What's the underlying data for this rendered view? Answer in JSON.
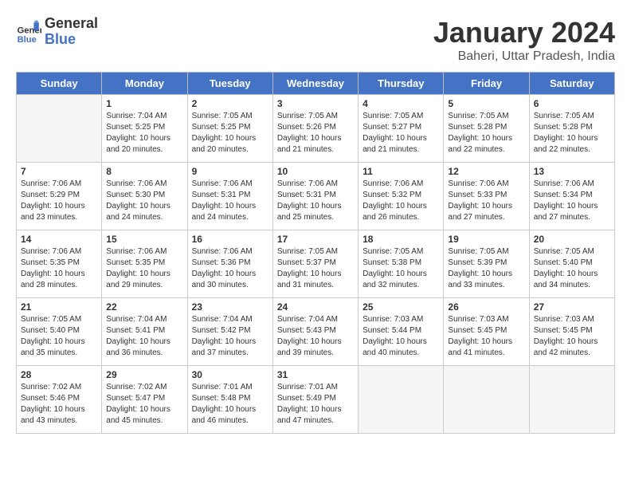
{
  "header": {
    "logo_line1": "General",
    "logo_line2": "Blue",
    "month": "January 2024",
    "location": "Baheri, Uttar Pradesh, India"
  },
  "days_of_week": [
    "Sunday",
    "Monday",
    "Tuesday",
    "Wednesday",
    "Thursday",
    "Friday",
    "Saturday"
  ],
  "weeks": [
    [
      {
        "num": "",
        "info": ""
      },
      {
        "num": "1",
        "info": "Sunrise: 7:04 AM\nSunset: 5:25 PM\nDaylight: 10 hours\nand 20 minutes."
      },
      {
        "num": "2",
        "info": "Sunrise: 7:05 AM\nSunset: 5:25 PM\nDaylight: 10 hours\nand 20 minutes."
      },
      {
        "num": "3",
        "info": "Sunrise: 7:05 AM\nSunset: 5:26 PM\nDaylight: 10 hours\nand 21 minutes."
      },
      {
        "num": "4",
        "info": "Sunrise: 7:05 AM\nSunset: 5:27 PM\nDaylight: 10 hours\nand 21 minutes."
      },
      {
        "num": "5",
        "info": "Sunrise: 7:05 AM\nSunset: 5:28 PM\nDaylight: 10 hours\nand 22 minutes."
      },
      {
        "num": "6",
        "info": "Sunrise: 7:05 AM\nSunset: 5:28 PM\nDaylight: 10 hours\nand 22 minutes."
      }
    ],
    [
      {
        "num": "7",
        "info": "Sunrise: 7:06 AM\nSunset: 5:29 PM\nDaylight: 10 hours\nand 23 minutes."
      },
      {
        "num": "8",
        "info": "Sunrise: 7:06 AM\nSunset: 5:30 PM\nDaylight: 10 hours\nand 24 minutes."
      },
      {
        "num": "9",
        "info": "Sunrise: 7:06 AM\nSunset: 5:31 PM\nDaylight: 10 hours\nand 24 minutes."
      },
      {
        "num": "10",
        "info": "Sunrise: 7:06 AM\nSunset: 5:31 PM\nDaylight: 10 hours\nand 25 minutes."
      },
      {
        "num": "11",
        "info": "Sunrise: 7:06 AM\nSunset: 5:32 PM\nDaylight: 10 hours\nand 26 minutes."
      },
      {
        "num": "12",
        "info": "Sunrise: 7:06 AM\nSunset: 5:33 PM\nDaylight: 10 hours\nand 27 minutes."
      },
      {
        "num": "13",
        "info": "Sunrise: 7:06 AM\nSunset: 5:34 PM\nDaylight: 10 hours\nand 27 minutes."
      }
    ],
    [
      {
        "num": "14",
        "info": "Sunrise: 7:06 AM\nSunset: 5:35 PM\nDaylight: 10 hours\nand 28 minutes."
      },
      {
        "num": "15",
        "info": "Sunrise: 7:06 AM\nSunset: 5:35 PM\nDaylight: 10 hours\nand 29 minutes."
      },
      {
        "num": "16",
        "info": "Sunrise: 7:06 AM\nSunset: 5:36 PM\nDaylight: 10 hours\nand 30 minutes."
      },
      {
        "num": "17",
        "info": "Sunrise: 7:05 AM\nSunset: 5:37 PM\nDaylight: 10 hours\nand 31 minutes."
      },
      {
        "num": "18",
        "info": "Sunrise: 7:05 AM\nSunset: 5:38 PM\nDaylight: 10 hours\nand 32 minutes."
      },
      {
        "num": "19",
        "info": "Sunrise: 7:05 AM\nSunset: 5:39 PM\nDaylight: 10 hours\nand 33 minutes."
      },
      {
        "num": "20",
        "info": "Sunrise: 7:05 AM\nSunset: 5:40 PM\nDaylight: 10 hours\nand 34 minutes."
      }
    ],
    [
      {
        "num": "21",
        "info": "Sunrise: 7:05 AM\nSunset: 5:40 PM\nDaylight: 10 hours\nand 35 minutes."
      },
      {
        "num": "22",
        "info": "Sunrise: 7:04 AM\nSunset: 5:41 PM\nDaylight: 10 hours\nand 36 minutes."
      },
      {
        "num": "23",
        "info": "Sunrise: 7:04 AM\nSunset: 5:42 PM\nDaylight: 10 hours\nand 37 minutes."
      },
      {
        "num": "24",
        "info": "Sunrise: 7:04 AM\nSunset: 5:43 PM\nDaylight: 10 hours\nand 39 minutes."
      },
      {
        "num": "25",
        "info": "Sunrise: 7:03 AM\nSunset: 5:44 PM\nDaylight: 10 hours\nand 40 minutes."
      },
      {
        "num": "26",
        "info": "Sunrise: 7:03 AM\nSunset: 5:45 PM\nDaylight: 10 hours\nand 41 minutes."
      },
      {
        "num": "27",
        "info": "Sunrise: 7:03 AM\nSunset: 5:45 PM\nDaylight: 10 hours\nand 42 minutes."
      }
    ],
    [
      {
        "num": "28",
        "info": "Sunrise: 7:02 AM\nSunset: 5:46 PM\nDaylight: 10 hours\nand 43 minutes."
      },
      {
        "num": "29",
        "info": "Sunrise: 7:02 AM\nSunset: 5:47 PM\nDaylight: 10 hours\nand 45 minutes."
      },
      {
        "num": "30",
        "info": "Sunrise: 7:01 AM\nSunset: 5:48 PM\nDaylight: 10 hours\nand 46 minutes."
      },
      {
        "num": "31",
        "info": "Sunrise: 7:01 AM\nSunset: 5:49 PM\nDaylight: 10 hours\nand 47 minutes."
      },
      {
        "num": "",
        "info": ""
      },
      {
        "num": "",
        "info": ""
      },
      {
        "num": "",
        "info": ""
      }
    ]
  ]
}
